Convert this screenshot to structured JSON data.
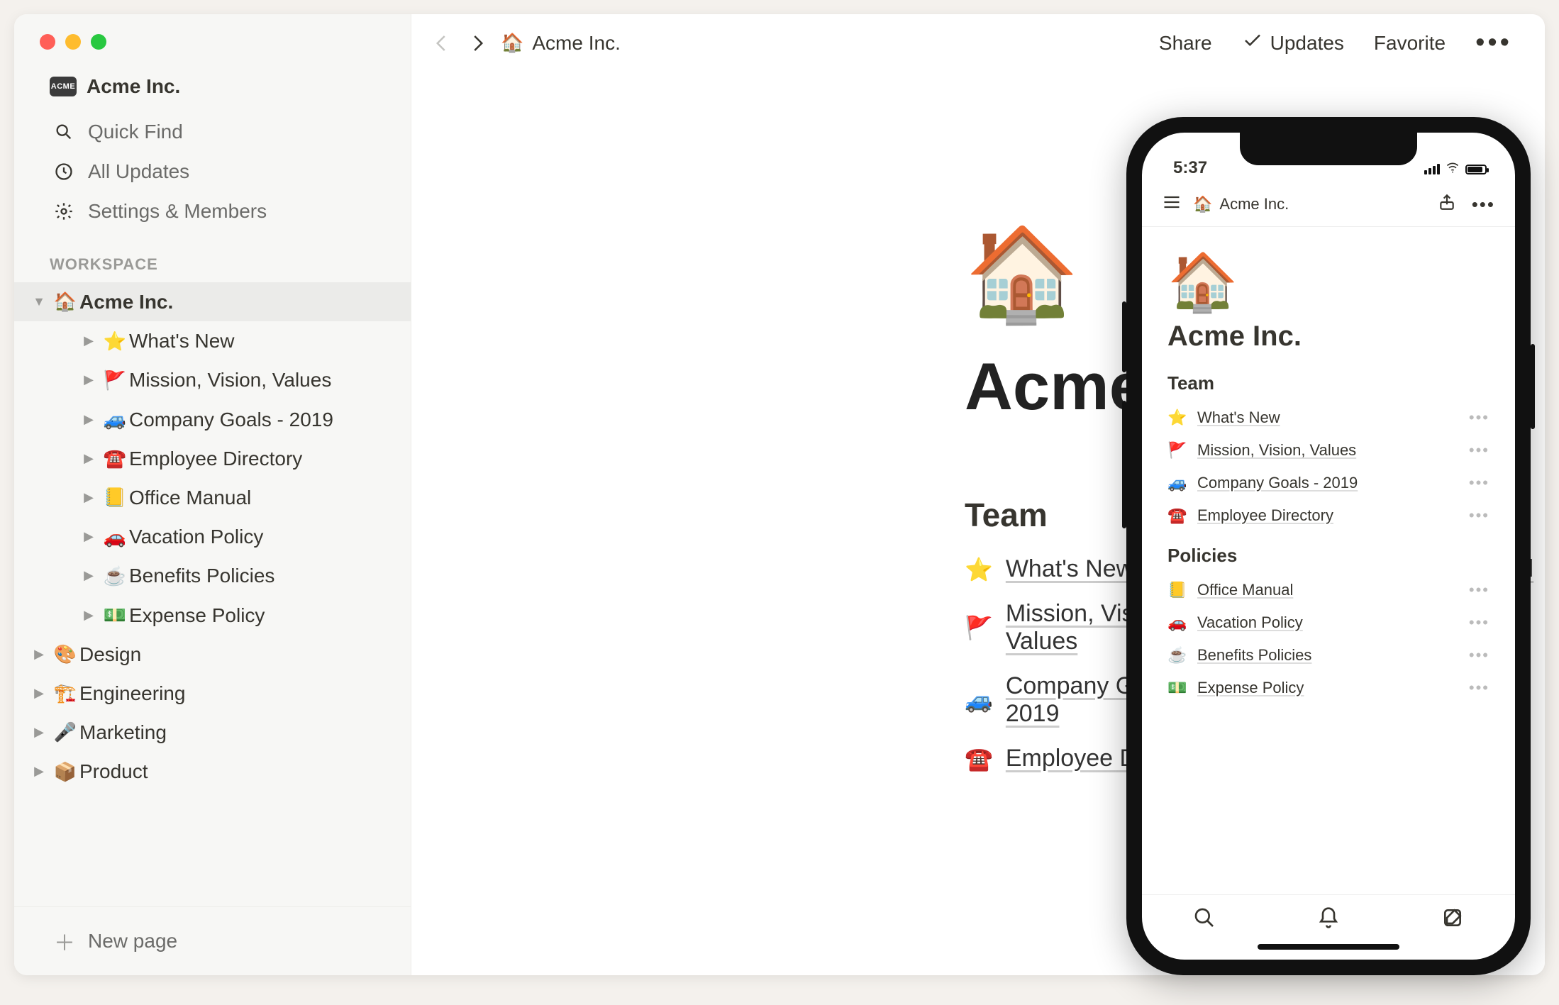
{
  "workspace": {
    "name": "Acme Inc.",
    "badge": "ACME"
  },
  "sidebar": {
    "quick_find": "Quick Find",
    "all_updates": "All Updates",
    "settings": "Settings & Members",
    "section_label": "WORKSPACE",
    "new_page": "New page",
    "tree": [
      {
        "emoji": "🏠",
        "label": "Acme Inc.",
        "depth": 0,
        "expanded": true,
        "active": true
      },
      {
        "emoji": "⭐",
        "label": "What's New",
        "depth": 1,
        "expanded": false
      },
      {
        "emoji": "🚩",
        "label": "Mission, Vision, Values",
        "depth": 1,
        "expanded": false
      },
      {
        "emoji": "🚙",
        "label": "Company Goals - 2019",
        "depth": 1,
        "expanded": false
      },
      {
        "emoji": "☎️",
        "label": "Employee Directory",
        "depth": 1,
        "expanded": false
      },
      {
        "emoji": "📒",
        "label": "Office Manual",
        "depth": 1,
        "expanded": false
      },
      {
        "emoji": "🚗",
        "label": "Vacation Policy",
        "depth": 1,
        "expanded": false
      },
      {
        "emoji": "☕",
        "label": "Benefits Policies",
        "depth": 1,
        "expanded": false
      },
      {
        "emoji": "💵",
        "label": "Expense Policy",
        "depth": 1,
        "expanded": false
      },
      {
        "emoji": "🎨",
        "label": "Design",
        "depth": 0,
        "expanded": false
      },
      {
        "emoji": "🏗️",
        "label": "Engineering",
        "depth": 0,
        "expanded": false
      },
      {
        "emoji": "🎤",
        "label": "Marketing",
        "depth": 0,
        "expanded": false
      },
      {
        "emoji": "📦",
        "label": "Product",
        "depth": 0,
        "expanded": false
      }
    ]
  },
  "topbar": {
    "breadcrumb_emoji": "🏠",
    "breadcrumb_title": "Acme Inc.",
    "share": "Share",
    "updates": "Updates",
    "favorite": "Favorite"
  },
  "page": {
    "hero_emoji": "🏠",
    "title": "Acme Inc.",
    "columns": [
      {
        "heading": "Team",
        "links": [
          {
            "emoji": "⭐",
            "label": "What's New"
          },
          {
            "emoji": "🚩",
            "label": "Mission, Vision, Values"
          },
          {
            "emoji": "🚙",
            "label": "Company Goals - 2019"
          },
          {
            "emoji": "☎️",
            "label": "Employee Directory"
          }
        ]
      },
      {
        "heading": "Policies",
        "links": [
          {
            "emoji": "📒",
            "label": "Office Manual"
          },
          {
            "emoji": "🚗",
            "label": "Vacation Policy"
          },
          {
            "emoji": "☕",
            "label": "Benefits Policies"
          },
          {
            "emoji": "💵",
            "label": "Expense Policy"
          }
        ]
      }
    ]
  },
  "mobile": {
    "time": "5:37",
    "breadcrumb_emoji": "🏠",
    "breadcrumb_title": "Acme Inc.",
    "hero_emoji": "🏠",
    "title": "Acme Inc.",
    "sections": [
      {
        "heading": "Team",
        "links": [
          {
            "emoji": "⭐",
            "label": "What's New"
          },
          {
            "emoji": "🚩",
            "label": "Mission, Vision, Values"
          },
          {
            "emoji": "🚙",
            "label": "Company Goals - 2019"
          },
          {
            "emoji": "☎️",
            "label": "Employee Directory"
          }
        ]
      },
      {
        "heading": "Policies",
        "links": [
          {
            "emoji": "📒",
            "label": "Office Manual"
          },
          {
            "emoji": "🚗",
            "label": "Vacation Policy"
          },
          {
            "emoji": "☕",
            "label": "Benefits Policies"
          },
          {
            "emoji": "💵",
            "label": "Expense Policy"
          }
        ]
      }
    ]
  }
}
